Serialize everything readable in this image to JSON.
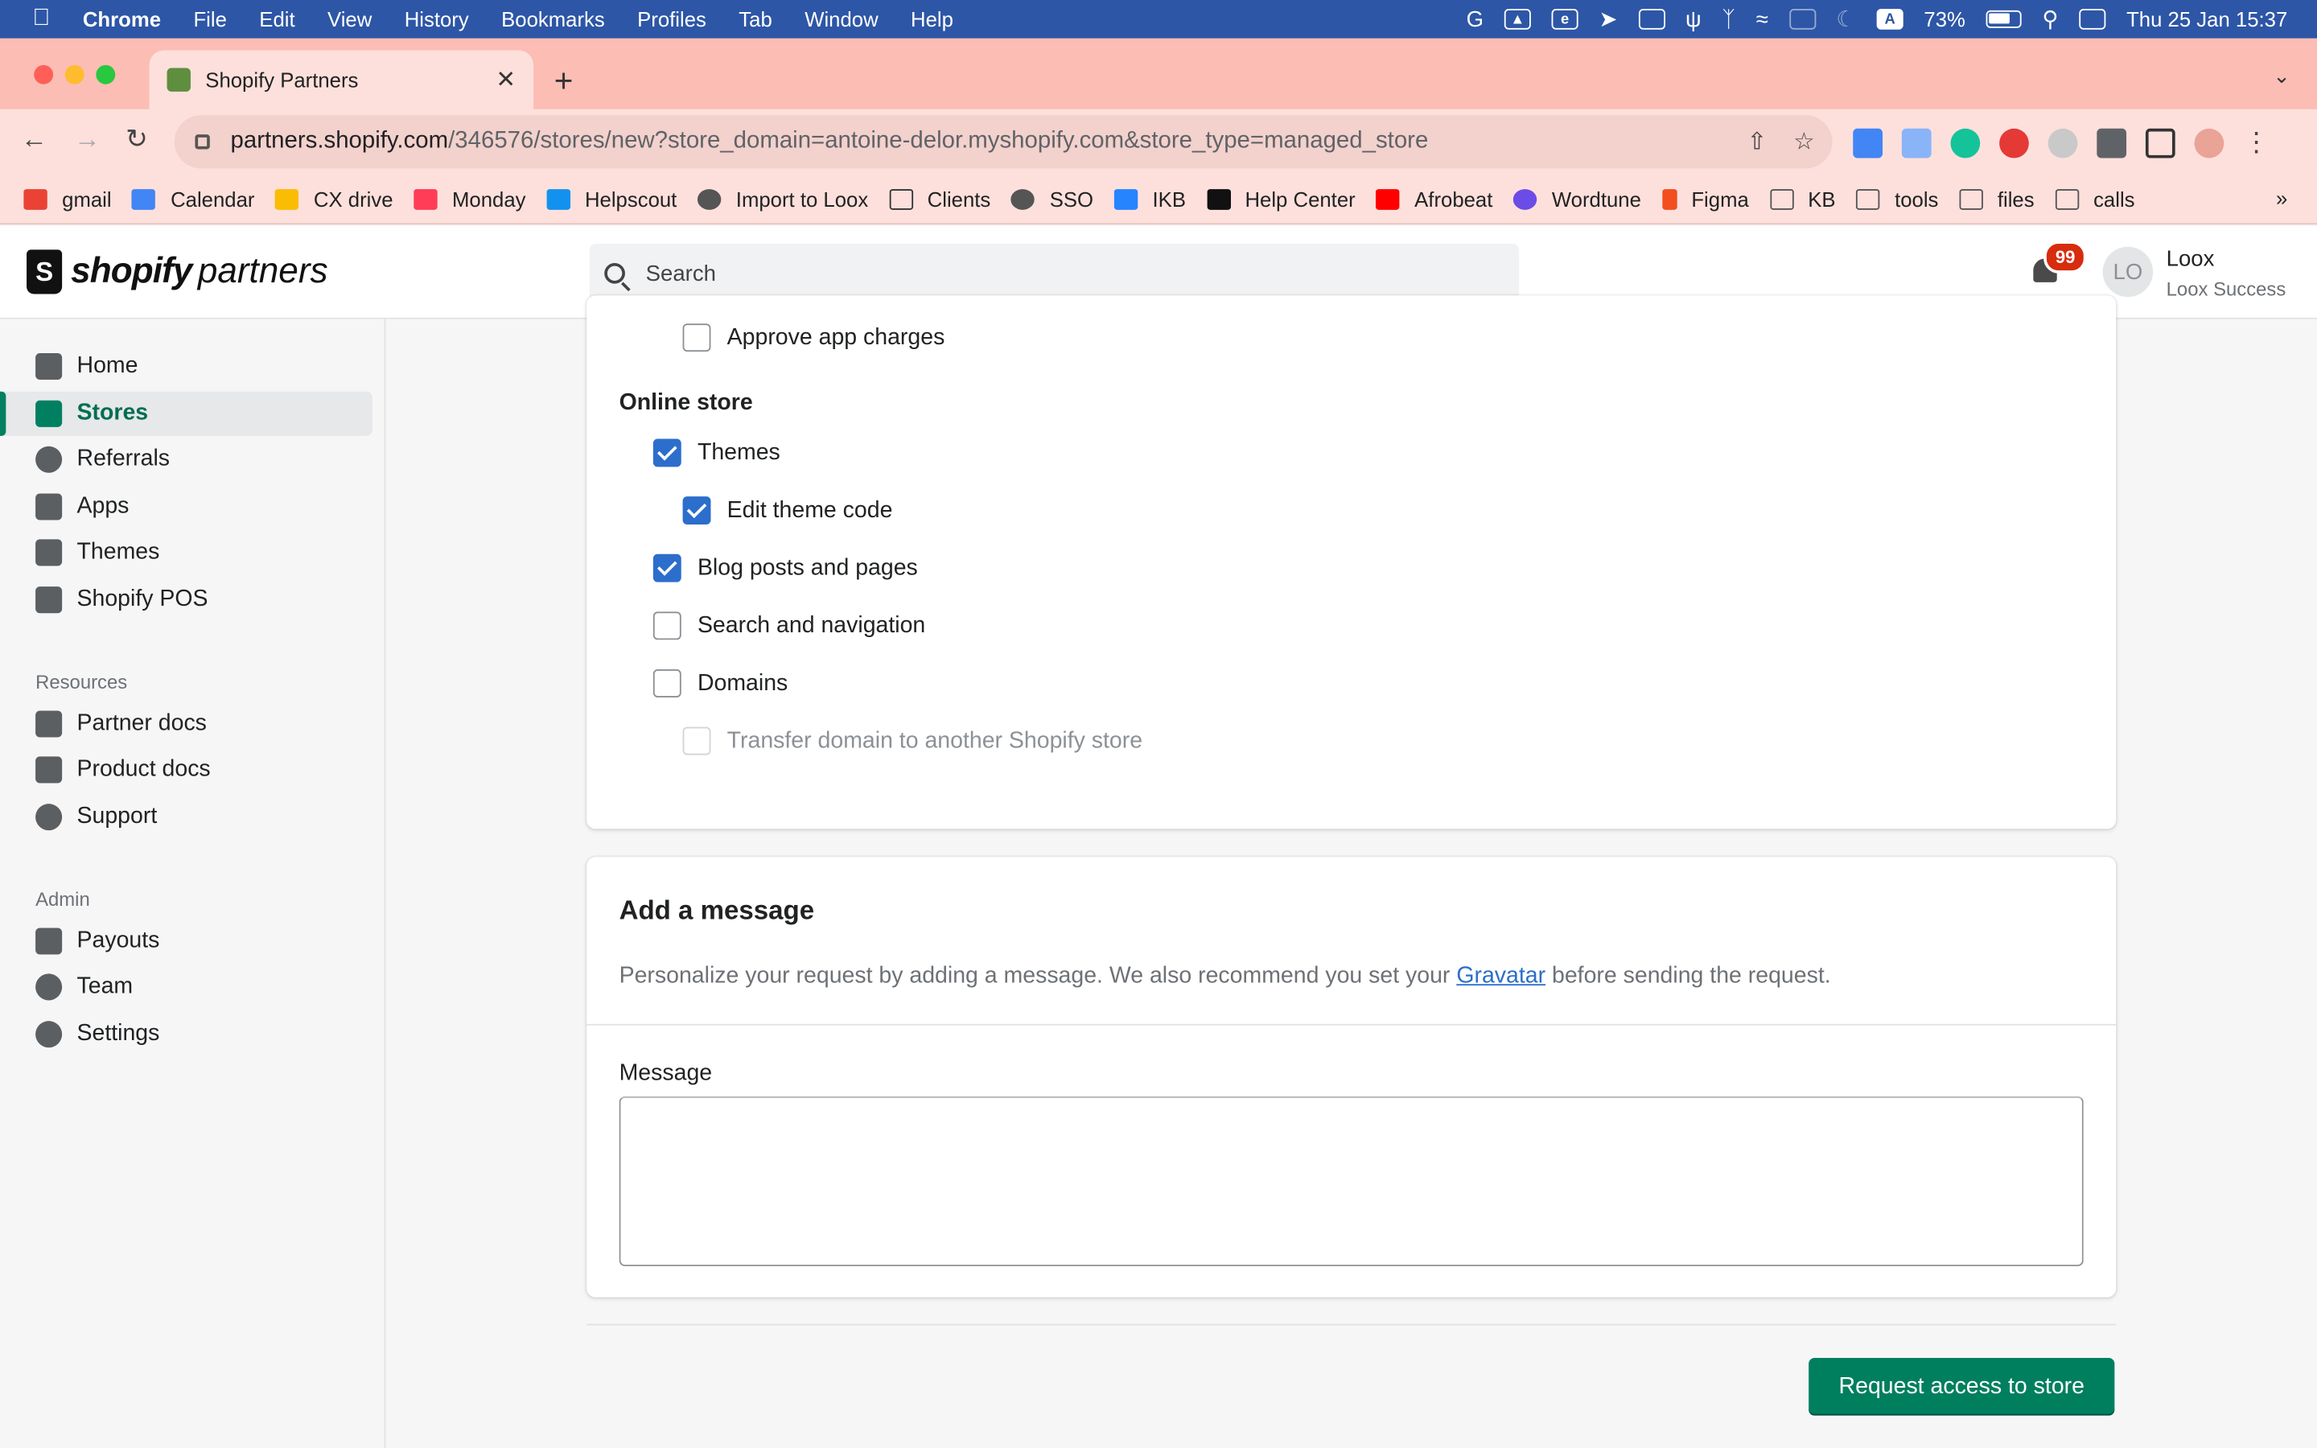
{
  "menubar": {
    "items": [
      "Chrome",
      "File",
      "Edit",
      "View",
      "History",
      "Bookmarks",
      "Profiles",
      "Tab",
      "Window",
      "Help"
    ],
    "battery": "73%",
    "datetime": "Thu 25 Jan  15:37"
  },
  "browser": {
    "tab_title": "Shopify Partners",
    "url_host": "partners.shopify.com",
    "url_path": "/346576/stores/new?store_domain=antoine-delor.myshopify.com&store_type=managed_store",
    "bookmarks": [
      "gmail",
      "Calendar",
      "CX drive",
      "Monday",
      "Helpscout",
      "Import to Loox",
      "Clients",
      "SSO",
      "IKB",
      "Help Center",
      "Afrobeat",
      "Wordtune",
      "Figma",
      "KB",
      "tools",
      "files",
      "calls"
    ],
    "bookmarks_more": "»"
  },
  "header": {
    "logo_shopify": "shopify",
    "logo_partners": "partners",
    "search_placeholder": "Search",
    "notification_count": "99",
    "avatar_initials": "LO",
    "user_name": "Loox",
    "user_org": "Loox Success"
  },
  "sidebar": {
    "main": [
      "Home",
      "Stores",
      "Referrals",
      "Apps",
      "Themes",
      "Shopify POS"
    ],
    "resources_title": "Resources",
    "resources": [
      "Partner docs",
      "Product docs",
      "Support"
    ],
    "admin_title": "Admin",
    "admin": [
      "Payouts",
      "Team",
      "Settings"
    ]
  },
  "permissions": {
    "approve_app_charges": "Approve app charges",
    "online_store_title": "Online store",
    "themes": "Themes",
    "edit_theme_code": "Edit theme code",
    "blog_posts": "Blog posts and pages",
    "search_nav": "Search and navigation",
    "domains": "Domains",
    "transfer_domain": "Transfer domain to another Shopify store"
  },
  "message_card": {
    "title": "Add a message",
    "desc_before": "Personalize your request by adding a message. We also recommend you set your ",
    "desc_link": "Gravatar",
    "desc_after": " before sending the request.",
    "field_label": "Message",
    "field_value": ""
  },
  "actions": {
    "submit": "Request access to store"
  }
}
